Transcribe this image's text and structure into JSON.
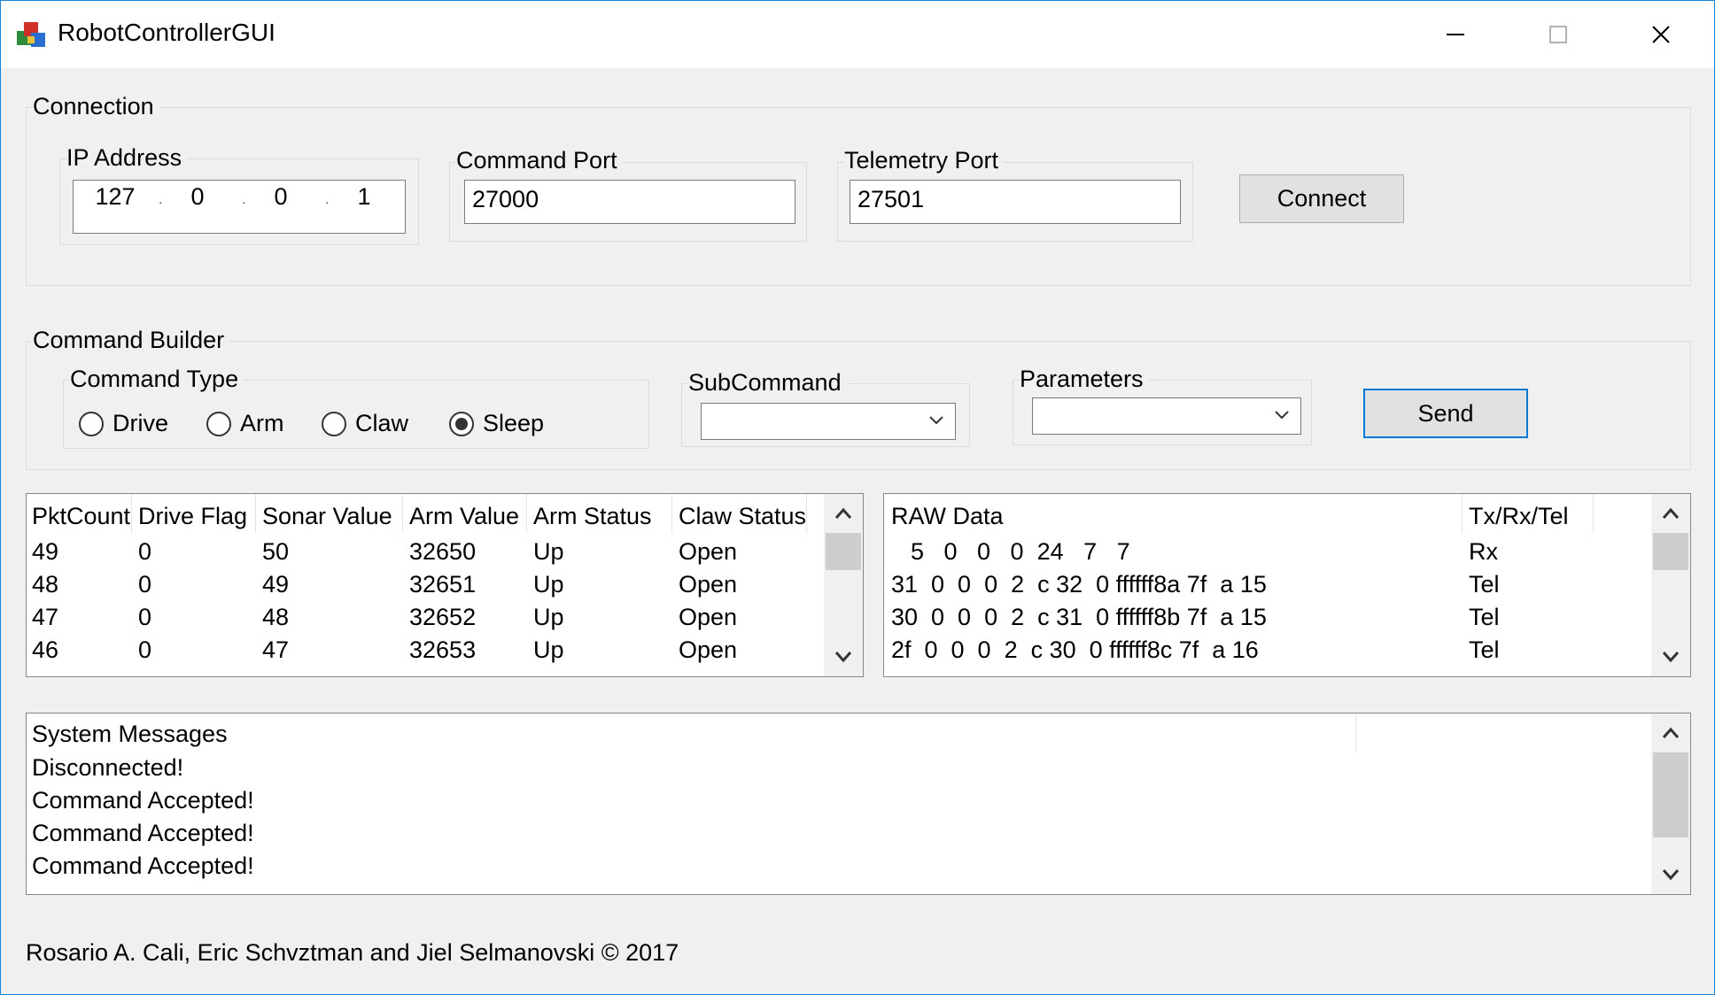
{
  "window": {
    "title": "RobotControllerGUI"
  },
  "connection": {
    "group_label": "Connection",
    "ip_label": "IP Address",
    "ip_octets": [
      "127",
      "0",
      "0",
      "1"
    ],
    "command_port_label": "Command Port",
    "command_port_value": "27000",
    "telemetry_port_label": "Telemetry Port",
    "telemetry_port_value": "27501",
    "connect_label": "Connect"
  },
  "command_builder": {
    "group_label": "Command Builder",
    "command_type_label": "Command Type",
    "radios": [
      {
        "label": "Drive",
        "selected": false
      },
      {
        "label": "Arm",
        "selected": false
      },
      {
        "label": "Claw",
        "selected": false
      },
      {
        "label": "Sleep",
        "selected": true
      }
    ],
    "subcommand_label": "SubCommand",
    "subcommand_value": "",
    "parameters_label": "Parameters",
    "parameters_value": "",
    "send_label": "Send"
  },
  "telemetry_table": {
    "columns": [
      "PktCount",
      "Drive Flag",
      "Sonar Value",
      "Arm Value",
      "Arm Status",
      "Claw Status"
    ],
    "rows": [
      [
        "49",
        "0",
        "50",
        "32650",
        "Up",
        "Open"
      ],
      [
        "48",
        "0",
        "49",
        "32651",
        "Up",
        "Open"
      ],
      [
        "47",
        "0",
        "48",
        "32652",
        "Up",
        "Open"
      ],
      [
        "46",
        "0",
        "47",
        "32653",
        "Up",
        "Open"
      ]
    ]
  },
  "raw_table": {
    "columns": [
      "RAW Data",
      "Tx/Rx/Tel"
    ],
    "rows": [
      [
        "5   0   0   0  24   7   7",
        "Rx"
      ],
      [
        "31  0  0  0  2  c 32  0 ffffff8a 7f  a 15",
        "Tel"
      ],
      [
        "30  0  0  0  2  c 31  0 ffffff8b 7f  a 15",
        "Tel"
      ],
      [
        "2f  0  0  0  2  c 30  0 ffffff8c 7f  a 16",
        "Tel"
      ]
    ]
  },
  "messages": {
    "header": "System Messages",
    "items": [
      "Disconnected!",
      "Command Accepted!",
      "Command Accepted!",
      "Command Accepted!"
    ]
  },
  "footer": {
    "credits": "Rosario A. Cali, Eric Schvztman and Jiel Selmanovski © 2017"
  },
  "colors": {
    "accent": "#0078d7",
    "window_border": "#1883d7",
    "background": "#f0f0f0"
  }
}
